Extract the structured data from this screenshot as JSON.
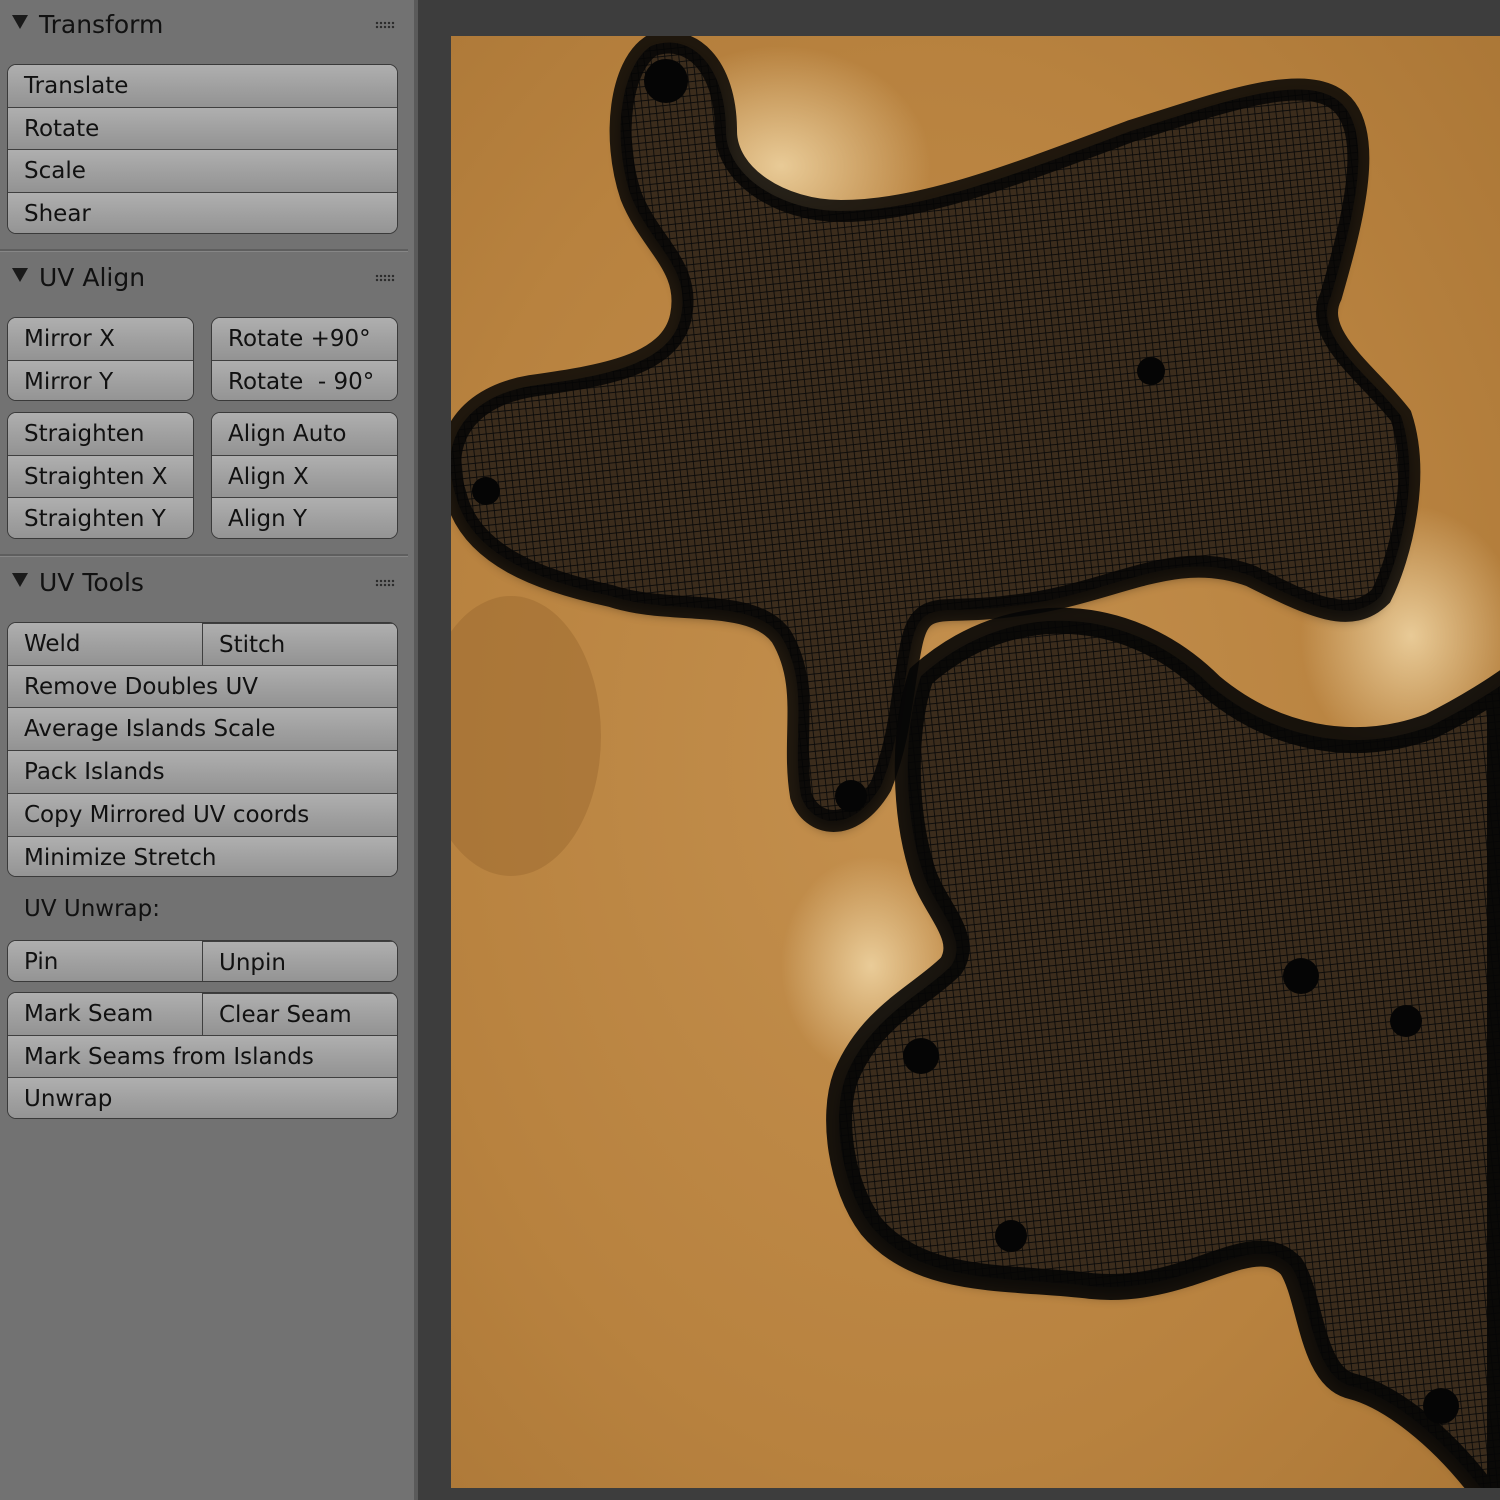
{
  "panels": {
    "transform": {
      "title": "Transform",
      "buttons": [
        "Translate",
        "Rotate",
        "Scale",
        "Shear"
      ]
    },
    "uv_align": {
      "title": "UV Align",
      "mirror": [
        "Mirror X",
        "Mirror Y"
      ],
      "rotate": [
        "Rotate +90°",
        "Rotate  - 90°"
      ],
      "straighten": [
        "Straighten",
        "Straighten X",
        "Straighten Y"
      ],
      "align": [
        "Align Auto",
        "Align X",
        "Align Y"
      ]
    },
    "uv_tools": {
      "title": "UV Tools",
      "weld": "Weld",
      "stitch": "Stitch",
      "buttons": [
        "Remove Doubles UV",
        "Average Islands Scale",
        "Pack Islands",
        "Copy Mirrored UV coords",
        "Minimize Stretch"
      ],
      "unwrap_label": "UV Unwrap:",
      "pin": "Pin",
      "unpin": "Unpin",
      "mark_seam": "Mark Seam",
      "clear_seam": "Clear Seam",
      "mark_seams_from_islands": "Mark Seams from Islands",
      "unwrap": "Unwrap"
    }
  },
  "icons": {
    "collapse": "triangle-down-icon",
    "grip": "drag-grip-icon"
  },
  "colors": {
    "panel_bg": "#727272",
    "button": "#a3a3a3",
    "texture": "#c8944e",
    "mesh": "#0a0a0a"
  }
}
